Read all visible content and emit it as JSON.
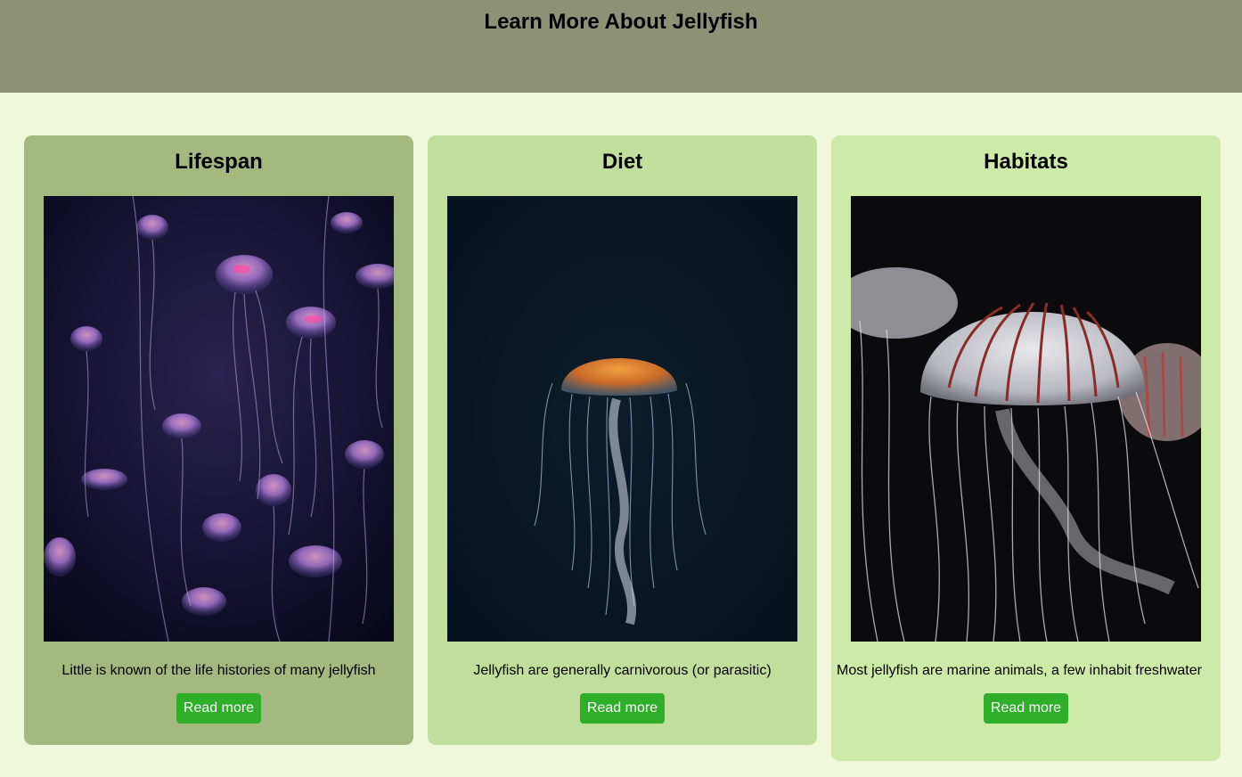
{
  "header": {
    "title": "Learn More About Jellyfish"
  },
  "cards": [
    {
      "title": "Lifespan",
      "image_alt": "jellyfish-swarm-photo",
      "text": "Little is known of the life histories of many jellyfish",
      "button_label": "Read more",
      "background": "#a4b880"
    },
    {
      "title": "Diet",
      "image_alt": "single-jellyfish-photo",
      "text": "Jellyfish are generally carnivorous (or parasitic)",
      "button_label": "Read more",
      "background": "#c0de9c"
    },
    {
      "title": "Habitats",
      "image_alt": "striped-jellyfish-photo",
      "text": "Most jellyfish are marine animals, a few inhabit freshwater",
      "button_label": "Read more",
      "background": "#cdeba8"
    }
  ],
  "colors": {
    "header_bg": "#8d9277",
    "page_bg": "#f0f8dc",
    "button_bg": "#2fae2a",
    "button_text": "#ffffff"
  }
}
